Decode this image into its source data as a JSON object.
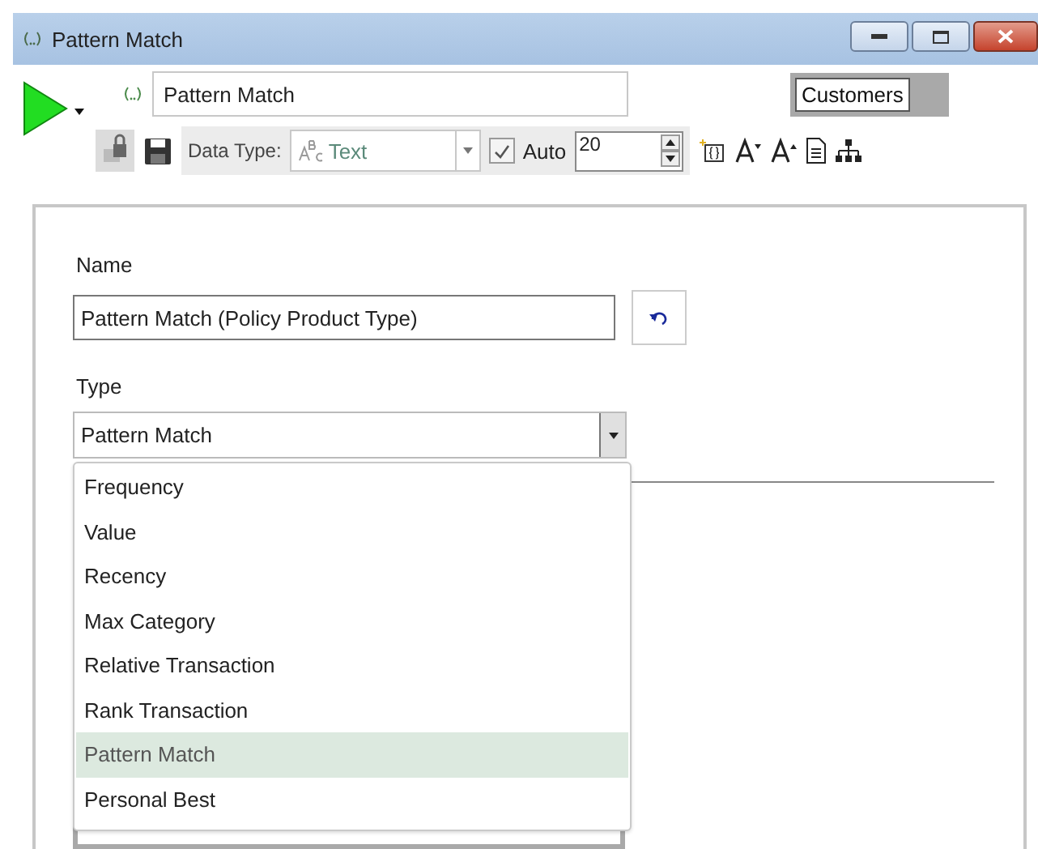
{
  "window": {
    "title": "Pattern Match"
  },
  "header": {
    "name_value": "Pattern Match",
    "scope_button": "Customers"
  },
  "toolbar": {
    "data_type_label": "Data Type:",
    "data_type_value": "Text",
    "data_type_disabled": true,
    "auto": {
      "label": "Auto",
      "checked": true
    },
    "size_value": "20"
  },
  "form": {
    "name_label": "Name",
    "name_value": "Pattern Match (Policy Product Type)",
    "type_label": "Type",
    "type_value": "Pattern Match",
    "type_options": [
      {
        "label": "Frequency",
        "selected": false
      },
      {
        "label": "Value",
        "selected": false
      },
      {
        "label": "Recency",
        "selected": false
      },
      {
        "label": "Max Category",
        "selected": false
      },
      {
        "label": "Relative Transaction",
        "selected": false
      },
      {
        "label": "Rank Transaction",
        "selected": false
      },
      {
        "label": "Pattern Match",
        "selected": true
      },
      {
        "label": "Personal Best",
        "selected": false
      }
    ]
  }
}
